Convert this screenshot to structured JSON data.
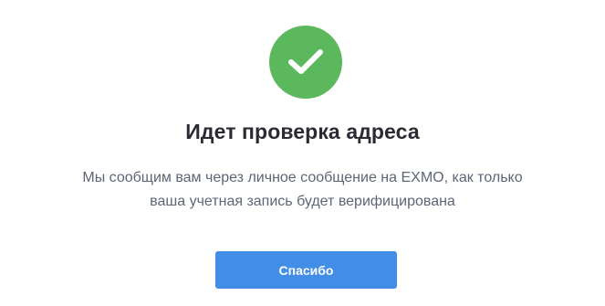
{
  "status": {
    "icon": "check-circle-icon",
    "color": "#5cb85c"
  },
  "title": "Идет проверка адреса",
  "message": {
    "line1": "Мы сообщим вам через личное сообщение на EXMO, как только",
    "line2": "ваша учетная запись будет верифицирована"
  },
  "button": {
    "label": "Спасибо",
    "color": "#428ee6"
  }
}
